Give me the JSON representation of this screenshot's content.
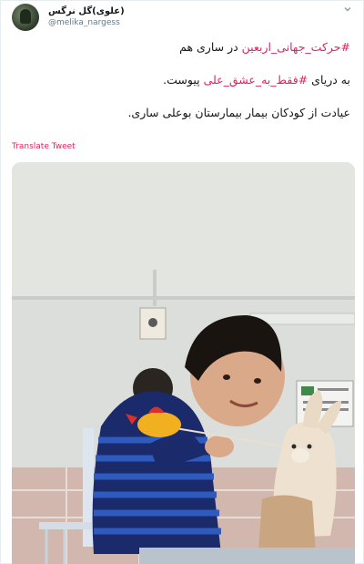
{
  "tweet": {
    "author": {
      "display_name": "(علوی)گل نرگس",
      "handle": "@melika_nargess",
      "avatar_icon": "avatar-photo"
    },
    "menu_icon": "chevron-down-icon",
    "line1": {
      "hashtag": "#حرکت_جهانی_اربعین",
      "text": " در ساری هم"
    },
    "line2": {
      "text_before": "به دریای ",
      "hashtag": "#فقط_به_عشق_علی",
      "text_after": " پیوست."
    },
    "line3": {
      "text": "عیادت از کودکان بیمار بیمارستان بوعلی ساری."
    },
    "translate_label": "Translate Tweet",
    "media": {
      "alt": "photo"
    }
  },
  "colors": {
    "link": "#e0245e",
    "text": "#14171a",
    "secondary": "#657786"
  }
}
